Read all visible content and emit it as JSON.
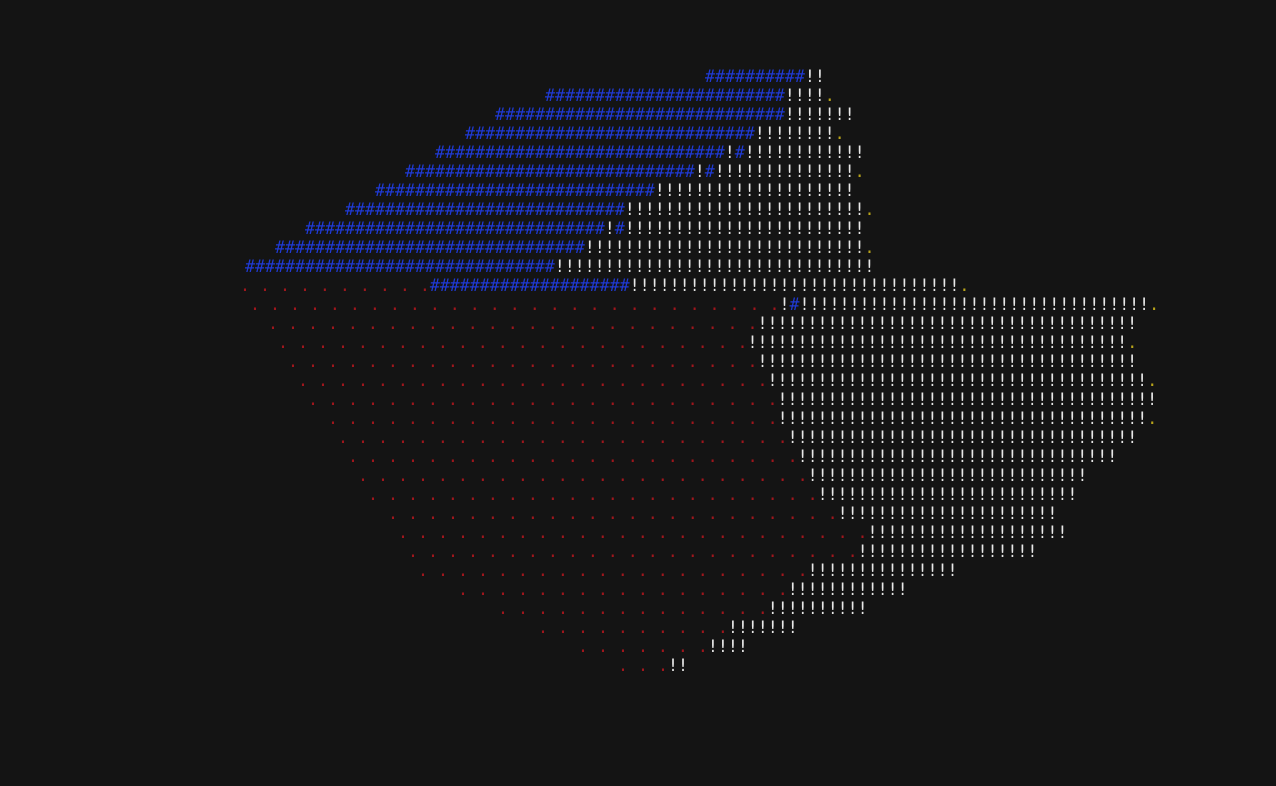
{
  "colors": {
    "background": "#141414",
    "blue": "#1f3ad6",
    "white": "#e8e8e8",
    "red": "#a0161c",
    "yellow": "#b9a41a"
  },
  "rows": [
    [
      {
        "c": "blue",
        "t": "##########"
      },
      {
        "c": "white",
        "t": "!!"
      }
    ],
    [
      {
        "c": "blue",
        "t": "########################"
      },
      {
        "c": "white",
        "t": "!!!!"
      },
      {
        "c": "yellow",
        "t": "."
      }
    ],
    [
      {
        "c": "blue",
        "t": "#############################"
      },
      {
        "c": "white",
        "t": "!!!!!!!"
      }
    ],
    [
      {
        "c": "blue",
        "t": "#############################"
      },
      {
        "c": "white",
        "t": "!!!!!!!!"
      },
      {
        "c": "yellow",
        "t": "."
      }
    ],
    [
      {
        "c": "blue",
        "t": "#############################"
      },
      {
        "c": "white",
        "t": "!"
      },
      {
        "c": "blue",
        "t": "#"
      },
      {
        "c": "white",
        "t": "!!!!!!!!!!!!"
      }
    ],
    [
      {
        "c": "blue",
        "t": "#############################"
      },
      {
        "c": "white",
        "t": "!"
      },
      {
        "c": "blue",
        "t": "#"
      },
      {
        "c": "white",
        "t": "!!!!!!!!!!!!!!"
      },
      {
        "c": "yellow",
        "t": "."
      }
    ],
    [
      {
        "c": "blue",
        "t": "############################"
      },
      {
        "c": "white",
        "t": "!!!!!!!!!!!!!!!!!!!!"
      }
    ],
    [
      {
        "c": "blue",
        "t": "############################"
      },
      {
        "c": "white",
        "t": "!!!!!!!!!!!!!!!!!!!!!!!!"
      },
      {
        "c": "yellow",
        "t": "."
      }
    ],
    [
      {
        "c": "blue",
        "t": "##############################"
      },
      {
        "c": "white",
        "t": "!"
      },
      {
        "c": "blue",
        "t": "#"
      },
      {
        "c": "white",
        "t": "!!!!!!!!!!!!!!!!!!!!!!!!"
      }
    ],
    [
      {
        "c": "blue",
        "t": "###############################"
      },
      {
        "c": "white",
        "t": "!!!!!!!!!!!!!!!!!!!!!!!!!!!!"
      },
      {
        "c": "yellow",
        "t": "."
      }
    ],
    [
      {
        "c": "blue",
        "t": "###############################"
      },
      {
        "c": "white",
        "t": "!!!!!!!!!!!!!!!!!!!!!!!!!!!!!!!!"
      }
    ],
    [
      {
        "c": "red",
        "t": ". . . . . . . . . ."
      },
      {
        "c": "blue",
        "t": "####################"
      },
      {
        "c": "white",
        "t": "!!!!!!!!!!!!!!!!!!!!!!!!!!!!!!!!!"
      },
      {
        "c": "yellow",
        "t": "."
      }
    ],
    [
      {
        "c": "red",
        "t": ". . . . . . . . . . . . . . . . . . . . . . . . . . ."
      },
      {
        "c": "white",
        "t": "!"
      },
      {
        "c": "blue",
        "t": "#"
      },
      {
        "c": "white",
        "t": "!!!!!!!!!!!!!!!!!!!!!!!!!!!!!!!!!!!"
      },
      {
        "c": "yellow",
        "t": "."
      }
    ],
    [
      {
        "c": "red",
        "t": ". . . . . . . . . . . . . . . . . . . . . . . . ."
      },
      {
        "c": "white",
        "t": "!!!!!!!!!!!!!!!!!!!!!!!!!!!!!!!!!!!!!!"
      }
    ],
    [
      {
        "c": "red",
        "t": ". . . . . . . . . . . . . . . . . . . . . . . ."
      },
      {
        "c": "white",
        "t": "!!!!!!!!!!!!!!!!!!!!!!!!!!!!!!!!!!!!!!"
      },
      {
        "c": "yellow",
        "t": "."
      }
    ],
    [
      {
        "c": "red",
        "t": ". . . . . . . . . . . . . . . . . . . . . . . ."
      },
      {
        "c": "white",
        "t": "!!!!!!!!!!!!!!!!!!!!!!!!!!!!!!!!!!!!!!"
      }
    ],
    [
      {
        "c": "red",
        "t": ". . . . . . . . . . . . . . . . . . . . . . . ."
      },
      {
        "c": "white",
        "t": "!!!!!!!!!!!!!!!!!!!!!!!!!!!!!!!!!!!!!!"
      },
      {
        "c": "yellow",
        "t": "."
      }
    ],
    [
      {
        "c": "red",
        "t": ". . . . . . . . . . . . . . . . . . . . . . . ."
      },
      {
        "c": "white",
        "t": "!!!!!!!!!!!!!!!!!!!!!!!!!!!!!!!!!!!!!!"
      }
    ],
    [
      {
        "c": "red",
        "t": ". . . . . . . . . . . . . . . . . . . . . . ."
      },
      {
        "c": "white",
        "t": "!!!!!!!!!!!!!!!!!!!!!!!!!!!!!!!!!!!!!"
      },
      {
        "c": "yellow",
        "t": "."
      }
    ],
    [
      {
        "c": "red",
        "t": ". . . . . . . . . . . . . . . . . . . . . . ."
      },
      {
        "c": "white",
        "t": "!!!!!!!!!!!!!!!!!!!!!!!!!!!!!!!!!!!"
      }
    ],
    [
      {
        "c": "red",
        "t": ". . . . . . . . . . . . . . . . . . . . . . ."
      },
      {
        "c": "white",
        "t": "!!!!!!!!!!!!!!!!!!!!!!!!!!!!!!!!"
      }
    ],
    [
      {
        "c": "red",
        "t": ". . . . . . . . . . . . . . . . . . . . . . ."
      },
      {
        "c": "white",
        "t": "!!!!!!!!!!!!!!!!!!!!!!!!!!!!"
      }
    ],
    [
      {
        "c": "red",
        "t": ". . . . . . . . . . . . . . . . . . . . . . ."
      },
      {
        "c": "white",
        "t": "!!!!!!!!!!!!!!!!!!!!!!!!!!"
      }
    ],
    [
      {
        "c": "red",
        "t": ". . . . . . . . . . . . . . . . . . . . . . ."
      },
      {
        "c": "white",
        "t": "!!!!!!!!!!!!!!!!!!!!!!"
      }
    ],
    [
      {
        "c": "red",
        "t": ". . . . . . . . . . . . . . . . . . . . . . . ."
      },
      {
        "c": "white",
        "t": "!!!!!!!!!!!!!!!!!!!!"
      }
    ],
    [
      {
        "c": "red",
        "t": ". . . . . . . . . . . . . . . . . . . . . . ."
      },
      {
        "c": "white",
        "t": "!!!!!!!!!!!!!!!!!!"
      }
    ],
    [
      {
        "c": "red",
        "t": ". . . . . . . . . . . . . . . . . . . ."
      },
      {
        "c": "white",
        "t": "!!!!!!!!!!!!!!!"
      }
    ],
    [
      {
        "c": "red",
        "t": ". . . . . . . . . . . . . . . . ."
      },
      {
        "c": "white",
        "t": "!!!!!!!!!!!!"
      }
    ],
    [
      {
        "c": "red",
        "t": ". . . . . . . . . . . . . ."
      },
      {
        "c": "white",
        "t": "!!!!!!!!!!"
      }
    ],
    [
      {
        "c": "red",
        "t": ". . . . . . . . . ."
      },
      {
        "c": "white",
        "t": "!!!!!!!"
      }
    ],
    [
      {
        "c": "red",
        "t": ". . . . . . ."
      },
      {
        "c": "white",
        "t": "!!!!"
      }
    ],
    [
      {
        "c": "red",
        "t": ". . ."
      },
      {
        "c": "white",
        "t": "!!"
      }
    ]
  ]
}
